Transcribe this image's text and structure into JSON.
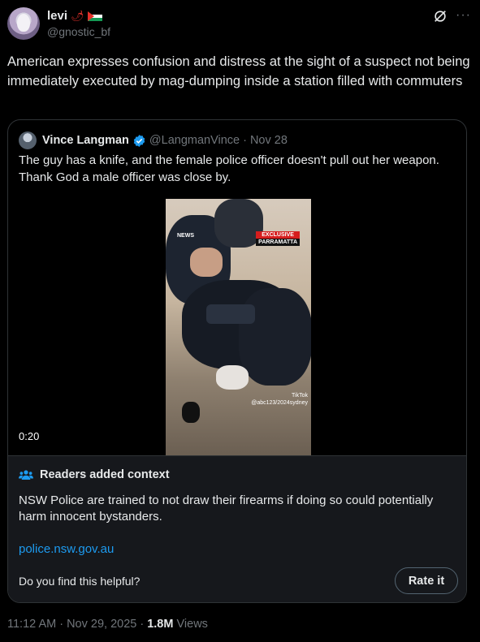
{
  "author": {
    "name": "levi",
    "emojis": "🌶",
    "handle": "@gnostic_bf"
  },
  "tweet": {
    "text": "American expresses confusion and distress at the sight of a suspect not being immediately executed by mag-dumping inside a station filled with commuters"
  },
  "quote": {
    "name": "Vince Langman",
    "handle": "@LangmanVince",
    "separator": "·",
    "date": "Nov 28",
    "text": "The guy has a knife, and the female police officer doesn't pull out her weapon. Thank God a male officer was close by.",
    "video": {
      "duration": "0:20",
      "badge_news": "NEWS",
      "badge_exclusive": "EXCLUSIVE",
      "badge_location": "PARRAMATTA",
      "watermark_brand": "TikTok",
      "watermark_handle": "@abc123/2024sydney"
    }
  },
  "context": {
    "title": "Readers added context",
    "body": "NSW Police are trained to not draw their firearms if doing so could potentially harm innocent bystanders.",
    "link": "police.nsw.gov.au",
    "question": "Do you find this helpful?",
    "rate_label": "Rate it"
  },
  "meta": {
    "time": "11:12 AM · Nov 29, 2025 · ",
    "views_count": "1.8M",
    "views_label": " Views"
  },
  "colors": {
    "background": "#000000",
    "text": "#e7e9ea",
    "secondary": "#71767b",
    "link": "#1d9bf0",
    "verified": "#1d9bf0",
    "context_bg": "#16181c"
  }
}
